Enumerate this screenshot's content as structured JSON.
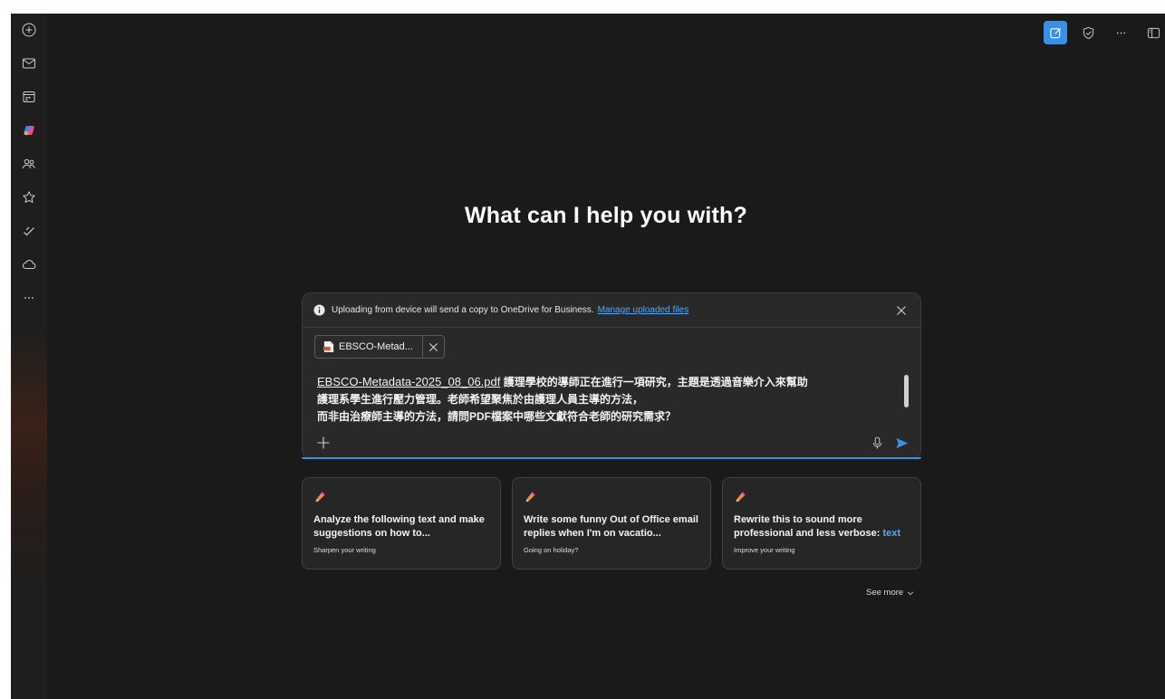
{
  "headline": "What can I help you with?",
  "rail": {
    "items": [
      {
        "icon": "plus-circle-icon"
      },
      {
        "icon": "mail-icon"
      },
      {
        "icon": "calendar-icon"
      },
      {
        "icon": "copilot-icon"
      },
      {
        "icon": "people-icon"
      },
      {
        "icon": "star-icon"
      },
      {
        "icon": "tasks-check-icon"
      },
      {
        "icon": "cloud-icon"
      },
      {
        "icon": "more-icon"
      }
    ]
  },
  "topbar": {
    "items": [
      {
        "icon": "new-chat-icon",
        "active": true
      },
      {
        "icon": "shield-icon"
      },
      {
        "icon": "more-options-icon",
        "text": "···"
      },
      {
        "icon": "sidebar-toggle-icon"
      }
    ]
  },
  "composer": {
    "notice_text": "Uploading from device will send a copy to OneDrive for Business.",
    "notice_link": "Manage uploaded files",
    "attachment_name": "EBSCO-Metad...",
    "prompt_file_ref": "EBSCO-Metadata-2025_08_06.pdf",
    "prompt_line1": " 護理學校的導師正在進行一項研究，主題是透過音樂介入來幫助",
    "prompt_line2": "護理系學生進行壓力管理。老師希望聚焦於由護理人員主導的方法，",
    "prompt_line3": "而非由治療師主導的方法，請問PDF檔案中哪些文獻符合老師的研究需求？"
  },
  "cards": [
    {
      "title": "Analyze the following text and make suggestions on how to...",
      "accent": "",
      "subtitle": "Sharpen your writing"
    },
    {
      "title": "Write some funny Out of Office email replies when I'm on vacatio...",
      "accent": "",
      "subtitle": "Going on holiday?"
    },
    {
      "title": "Rewrite this to sound more professional and less verbose: ",
      "accent": "text",
      "subtitle": "Improve your writing"
    }
  ],
  "see_more": "See more",
  "colors": {
    "accent": "#3a8fe6",
    "link": "#5aa6f0",
    "background": "#1a1a1a",
    "card": "#262626"
  }
}
